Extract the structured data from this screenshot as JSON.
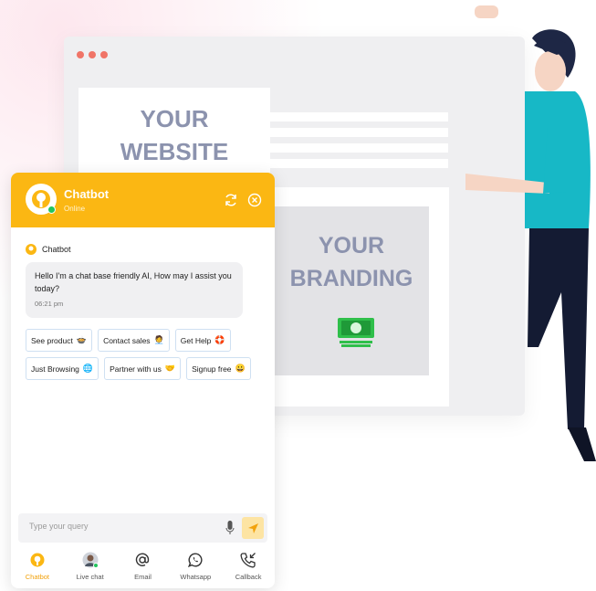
{
  "mockup": {
    "website_text": "YOUR\nWEBSITE",
    "branding_text": "YOUR\nBRANDING",
    "money_icon": "money-bill-icon"
  },
  "chatbot": {
    "header": {
      "name": "Chatbot",
      "status": "Online",
      "refresh_icon": "refresh-icon",
      "close_icon": "close-icon"
    },
    "message": {
      "sender": "Chatbot",
      "text": "Hello I'm a chat base friendly AI, How may I assist you today?",
      "time": "06:21 pm"
    },
    "chips": [
      {
        "label": "See product",
        "emoji": "🍲"
      },
      {
        "label": "Contact sales",
        "emoji": "🧑‍💼"
      },
      {
        "label": "Get Help",
        "emoji": "🛟"
      },
      {
        "label": "Just Browsing",
        "emoji": "🌐"
      },
      {
        "label": "Partner with us",
        "emoji": "🤝"
      },
      {
        "label": "Signup free",
        "emoji": "😀"
      }
    ],
    "input": {
      "placeholder": "Type your query"
    },
    "nav": [
      {
        "label": "Chatbot",
        "icon": "chatbot-icon",
        "active": true
      },
      {
        "label": "Live chat",
        "icon": "agent-avatar-icon",
        "active": false
      },
      {
        "label": "Email",
        "icon": "at-icon",
        "active": false
      },
      {
        "label": "Whatsapp",
        "icon": "whatsapp-icon",
        "active": false
      },
      {
        "label": "Callback",
        "icon": "callback-phone-icon",
        "active": false
      }
    ],
    "colors": {
      "accent": "#fbb713",
      "chip_border": "#cfe0f2",
      "online": "#22c55e"
    }
  }
}
